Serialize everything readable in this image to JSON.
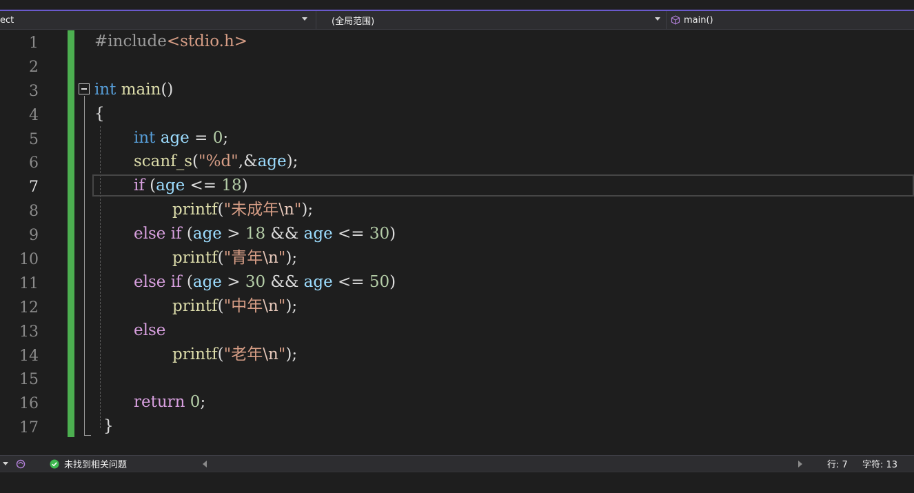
{
  "navbar": {
    "project_text": "ect",
    "scope_text": "(全局范围)",
    "function_text": "main()",
    "function_icon": "cube-icon"
  },
  "editor": {
    "line_numbers": [
      "1",
      "2",
      "3",
      "4",
      "5",
      "6",
      "7",
      "8",
      "9",
      "10",
      "11",
      "12",
      "13",
      "14",
      "15",
      "16",
      "17"
    ],
    "active_line": "7",
    "lines": {
      "l1": {
        "pp": "#include",
        "inc": "<stdio.h>"
      },
      "l3": {
        "kw": "int",
        "fn": "main",
        "rest": "()"
      },
      "l4": {
        "text": "{"
      },
      "l5": {
        "kw": "int",
        "var": "age",
        "op": " = ",
        "num": "0",
        "end": ";"
      },
      "l6": {
        "fn": "scanf_s",
        "p1": "(",
        "str": "\"%d\"",
        "p2": ",&",
        "var": "age",
        "end": ");"
      },
      "l7": {
        "ctl": "if",
        "p1": " (",
        "var": "age",
        "op": " <= ",
        "num": "18",
        "end": ")"
      },
      "l8": {
        "fn": "printf",
        "p1": "(",
        "str": "\"未成年",
        "esc": "\\n",
        "str2": "\"",
        "end": ");"
      },
      "l9": {
        "ctl": "else if",
        "p1": " (",
        "var": "age",
        "op1": " > ",
        "num1": "18",
        "op2": " && ",
        "var2": "age",
        "op3": " <= ",
        "num2": "30",
        "end": ")"
      },
      "l10": {
        "fn": "printf",
        "p1": "(",
        "str": "\"青年",
        "esc": "\\n",
        "str2": "\"",
        "end": ");"
      },
      "l11": {
        "ctl": "else if",
        "p1": " (",
        "var": "age",
        "op1": " > ",
        "num1": "30",
        "op2": " && ",
        "var2": "age",
        "op3": " <= ",
        "num2": "50",
        "end": ")"
      },
      "l12": {
        "fn": "printf",
        "p1": "(",
        "str": "\"中年",
        "esc": "\\n",
        "str2": "\"",
        "end": ");"
      },
      "l13": {
        "ctl": "else"
      },
      "l14": {
        "fn": "printf",
        "p1": "(",
        "str": "\"老年",
        "esc": "\\n",
        "str2": "\"",
        "end": ");"
      },
      "l16": {
        "ctl": "return",
        "sp": " ",
        "num": "0",
        "end": ";"
      },
      "l17": {
        "text": "}"
      }
    }
  },
  "status": {
    "issues_text": "未找到相关问题",
    "issues_icon": "check-circle-icon",
    "line_label": "行: 7",
    "char_label": "字符: 13"
  },
  "colors": {
    "keyword": "#569cd6",
    "control": "#d8a0df",
    "function": "#dcdcaa",
    "variable": "#9cdcfe",
    "number": "#b5cea8",
    "string": "#d69d85",
    "change_bar": "#4caf50"
  }
}
